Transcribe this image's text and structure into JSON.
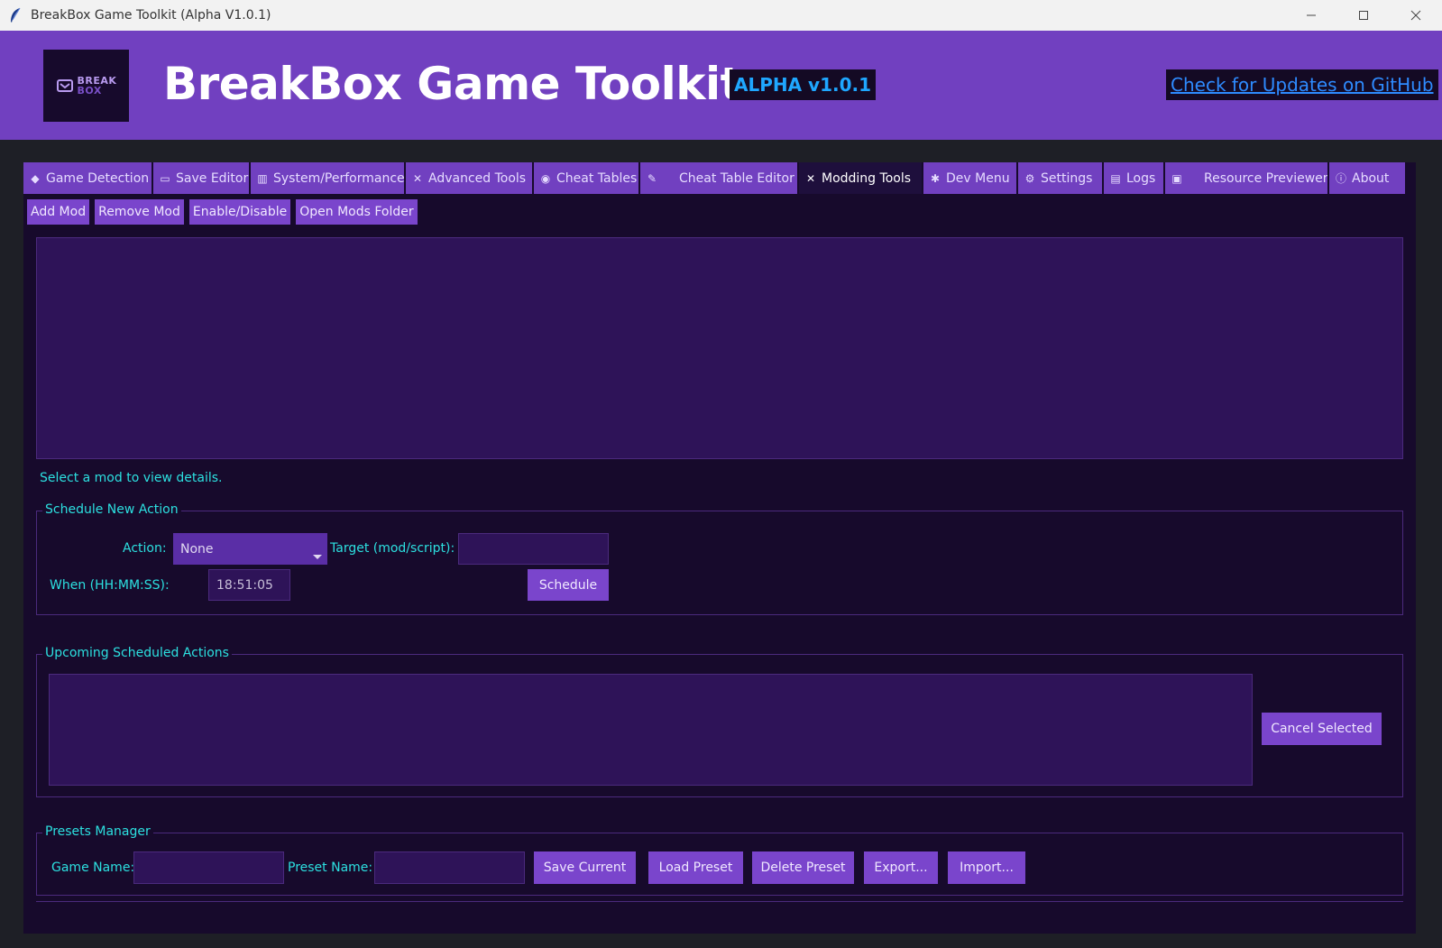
{
  "window": {
    "title": "BreakBox Game Toolkit (Alpha V1.0.1)",
    "controls": [
      "minimize-icon",
      "maximize-icon",
      "close-icon"
    ]
  },
  "header": {
    "logo_line1": "BREAK",
    "logo_line2": "BOX",
    "title": "BreakBox Game Toolkit",
    "badge": "ALPHA v1.0.1",
    "update_link": "Check for Updates on GitHub"
  },
  "colors": {
    "accent": "#7140c0",
    "frame_bg": "#170a2c",
    "list_bg": "#2e1358",
    "label_cyan": "#2ce0e0",
    "badge_blue": "#1fa7ff"
  },
  "tabs": [
    {
      "label": "Game Detection",
      "icon": "gamepad-icon"
    },
    {
      "label": "Save Editor",
      "icon": "folder-icon"
    },
    {
      "label": "System/Performance",
      "icon": "chart-icon"
    },
    {
      "label": "Advanced Tools",
      "icon": "tools-icon"
    },
    {
      "label": "Cheat Tables",
      "icon": "cheat-icon"
    },
    {
      "label": "Cheat Table Editor",
      "icon": "pencil-icon"
    },
    {
      "label": "Modding Tools",
      "icon": "wrench-icon",
      "active": true
    },
    {
      "label": "Dev Menu",
      "icon": "bug-icon"
    },
    {
      "label": "Settings",
      "icon": "gear-icon"
    },
    {
      "label": "Logs",
      "icon": "log-icon"
    },
    {
      "label": "Resource Previewer",
      "icon": "image-icon"
    },
    {
      "label": "About",
      "icon": "info-icon"
    }
  ],
  "mod_toolbar": {
    "add": "Add Mod",
    "remove": "Remove Mod",
    "toggle": "Enable/Disable",
    "open_folder": "Open Mods Folder"
  },
  "mod_details": "Select a mod to view details.",
  "schedule": {
    "legend": "Schedule New Action",
    "action_label": "Action:",
    "action_value": "None",
    "target_label": "Target (mod/script):",
    "target_value": "",
    "when_label": "When (HH:MM:SS):",
    "when_value": "18:51:05",
    "schedule_button": "Schedule"
  },
  "upcoming": {
    "legend": "Upcoming Scheduled Actions",
    "cancel_button": "Cancel Selected"
  },
  "presets": {
    "legend": "Presets Manager",
    "game_label": "Game Name:",
    "game_value": "",
    "preset_label": "Preset Name:",
    "preset_value": "",
    "save": "Save Current",
    "load": "Load Preset",
    "delete": "Delete Preset",
    "export": "Export...",
    "import": "Import..."
  }
}
